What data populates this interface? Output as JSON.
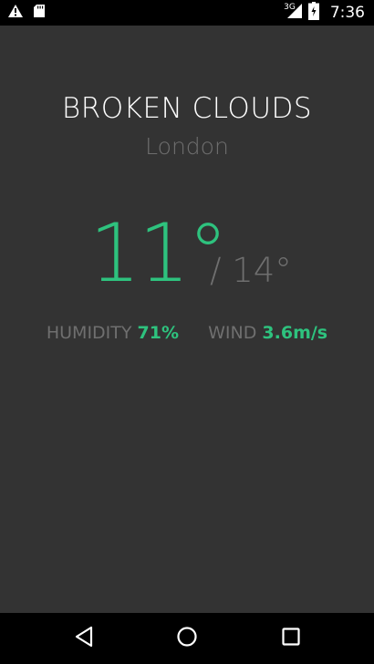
{
  "status_bar": {
    "network_type": "3G",
    "time": "7:36",
    "icons": [
      "warning-icon",
      "sd-card-icon",
      "signal-icon",
      "battery-icon"
    ]
  },
  "weather": {
    "condition": "BROKEN CLOUDS",
    "city": "London",
    "temperature": "11°",
    "high_temperature": "/ 14°",
    "humidity_label": "HUMIDITY",
    "humidity_value": "71%",
    "wind_label": "WIND",
    "wind_value": "3.6m/s"
  },
  "nav_bar": {
    "icons": [
      "back-icon",
      "home-icon",
      "recents-icon"
    ]
  },
  "colors": {
    "background": "#333333",
    "accent": "#2ec27e",
    "muted": "#6f6f6f",
    "bars": "#000000"
  }
}
